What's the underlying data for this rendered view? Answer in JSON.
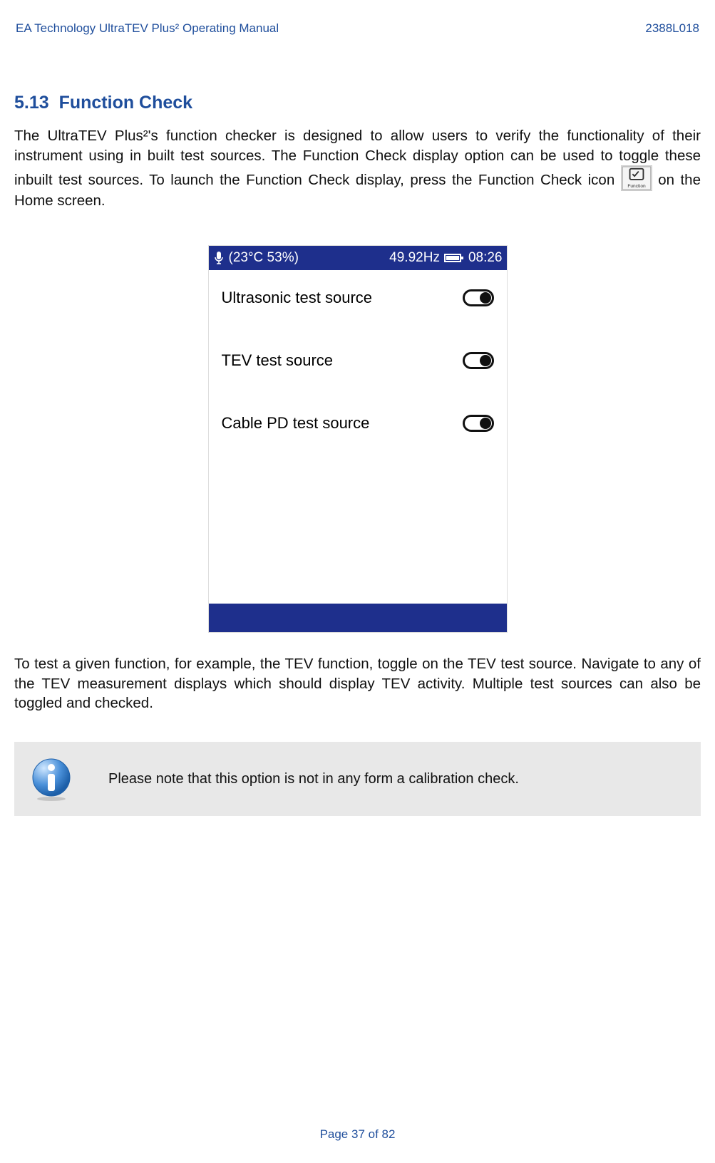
{
  "header": {
    "left": "EA Technology UltraTEV Plus² Operating Manual",
    "right": "2388L018"
  },
  "section": {
    "number": "5.13",
    "title": "Function Check"
  },
  "para1_a": "The UltraTEV Plus²'s function checker is designed to allow users to verify the functionality of their instrument using in built test sources. The Function Check display option can be used to toggle these inbuilt test sources. To launch the Function Check display, press the Function Check icon ",
  "para1_b": " on the Home screen.",
  "device": {
    "status": {
      "tempHumidity": "(23°C  53%)",
      "frequency": "49.92Hz",
      "time": "08:26"
    },
    "rows": [
      {
        "label": "Ultrasonic test source",
        "on": false
      },
      {
        "label": "TEV test source",
        "on": false
      },
      {
        "label": "Cable PD test source",
        "on": false
      }
    ]
  },
  "para2": "To test a given function, for example, the TEV function, toggle on the TEV test source. Navigate to any of the TEV measurement displays which should display TEV activity. Multiple test sources can also be toggled and checked.",
  "note": "Please note that this option is not in any form a calibration check.",
  "footer": "Page 37 of 82"
}
